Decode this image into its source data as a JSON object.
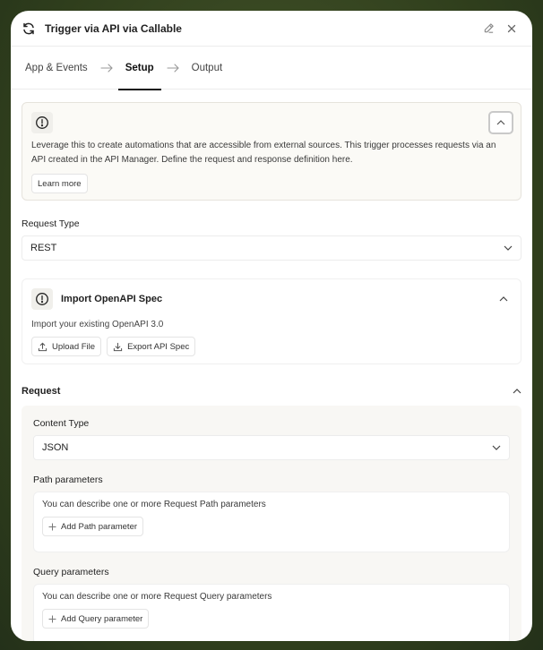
{
  "header": {
    "title": "Trigger via API via Callable",
    "edit_icon": "pencil-icon",
    "close_icon": "close-icon"
  },
  "tabs": [
    {
      "label": "App & Events"
    },
    {
      "label": "Setup",
      "active": true
    },
    {
      "label": "Output"
    }
  ],
  "info": {
    "text": "Leverage this to create automations that are accessible from external sources. This trigger processes requests via an API created in the API Manager. Define the request and response definition here.",
    "learn_more": "Learn more"
  },
  "request_type": {
    "label": "Request Type",
    "value": "REST"
  },
  "import_spec": {
    "title": "Import OpenAPI Spec",
    "subtitle": "Import your existing OpenAPI 3.0",
    "upload": "Upload File",
    "export": "Export API Spec"
  },
  "request": {
    "title": "Request",
    "content_type_label": "Content Type",
    "content_type_value": "JSON",
    "path_label": "Path parameters",
    "path_text": "You can describe one or more Request Path parameters",
    "path_button": "Add Path parameter",
    "query_label": "Query parameters",
    "query_text": "You can describe one or more Request Query parameters",
    "query_button": "Add Query parameter"
  }
}
